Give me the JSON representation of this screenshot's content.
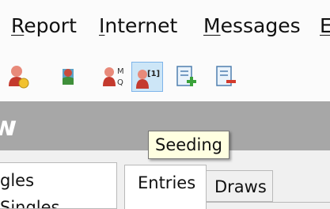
{
  "menu": [
    {
      "accel": "R",
      "rest": "eport"
    },
    {
      "accel": "I",
      "rest": "nternet"
    },
    {
      "accel": "M",
      "rest": "essages"
    },
    {
      "accel": "E",
      "rest": ""
    }
  ],
  "tooltip": "Seeding",
  "banner": "w",
  "left_list": [
    "gles",
    "Singles"
  ],
  "tabs": [
    "Entries",
    "Draws"
  ],
  "colors": {
    "accent": "#cde6f7",
    "banner": "#a7a7a7",
    "tooltip_bg": "#ffffe1"
  }
}
